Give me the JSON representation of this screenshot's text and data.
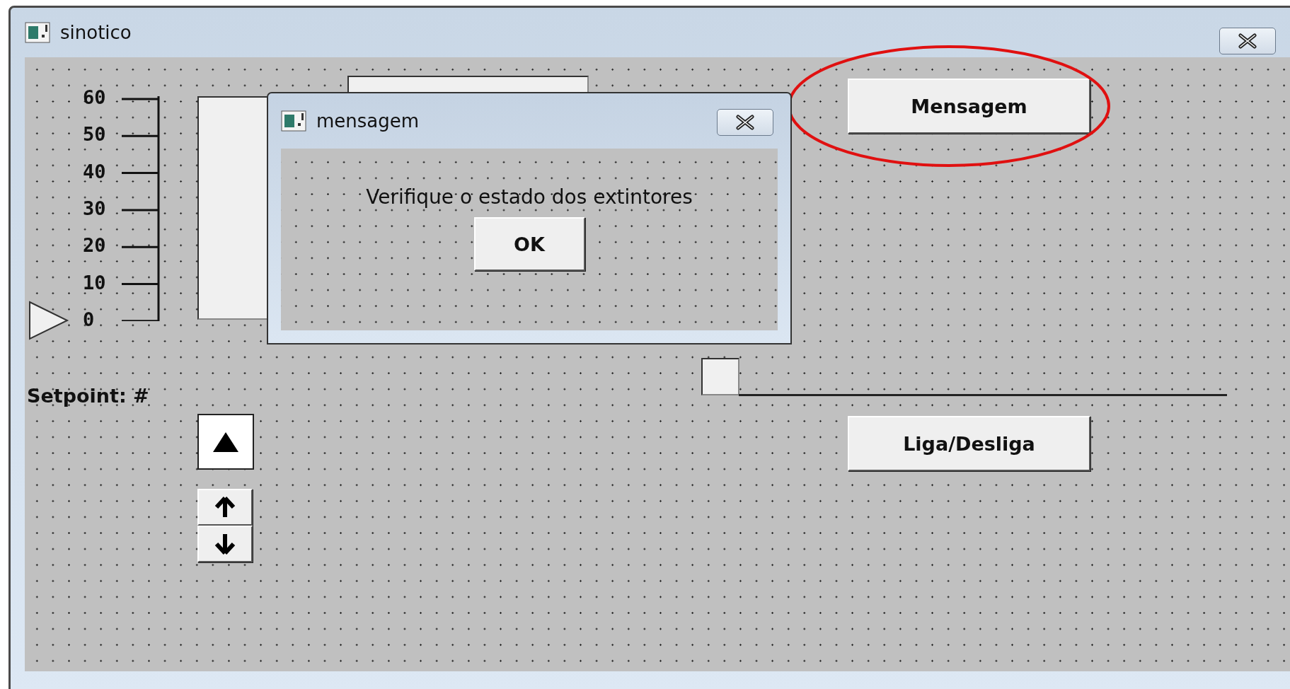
{
  "window": {
    "title": "sinotico"
  },
  "scale": {
    "labels": [
      "60",
      "50",
      "40",
      "30",
      "20",
      "10",
      "0"
    ]
  },
  "setpoint": {
    "label": "Setpoint: #"
  },
  "buttons": [
    {
      "kind": "message",
      "label": "Mensagem",
      "highlighted": true
    },
    {
      "kind": "toggle",
      "label": "Liga/Desliga",
      "highlighted": false
    }
  ],
  "dialog": {
    "title": "mensagem",
    "message": "Verifique o estado dos extintores",
    "button": "OK"
  }
}
